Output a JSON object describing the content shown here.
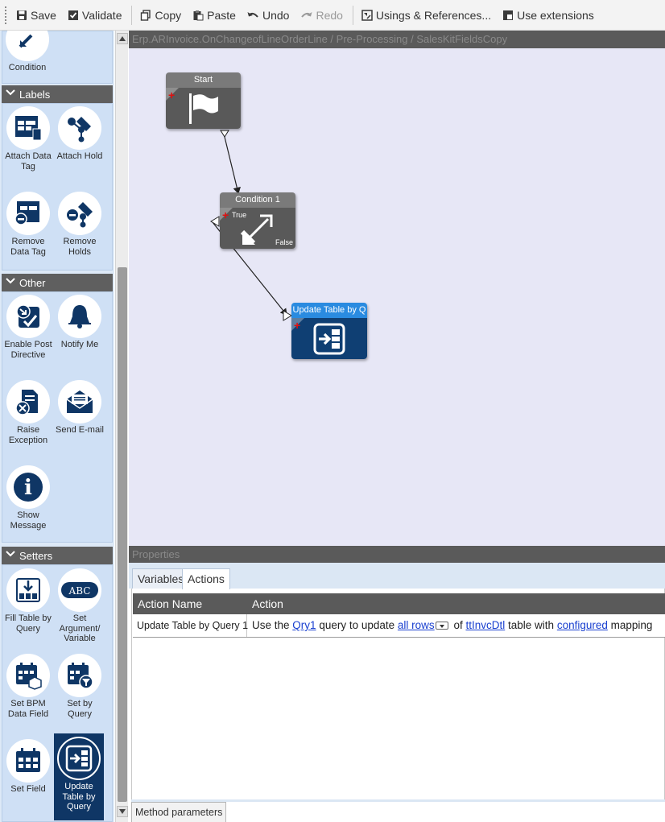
{
  "toolbar": {
    "save": "Save",
    "validate": "Validate",
    "copy": "Copy",
    "paste": "Paste",
    "undo": "Undo",
    "redo": "Redo",
    "usings": "Usings & References...",
    "extensions": "Use extensions"
  },
  "palette": {
    "top_item": "Condition",
    "groups": [
      {
        "name": "Labels",
        "items": [
          "Attach Data Tag",
          "Attach Hold",
          "Remove Data Tag",
          "Remove Holds"
        ]
      },
      {
        "name": "Other",
        "items": [
          "Enable Post Directive",
          "Notify Me",
          "Raise Exception",
          "Send E-mail",
          "Show Message"
        ]
      },
      {
        "name": "Setters",
        "items": [
          "Fill Table by Query",
          "Set Argument/ Variable",
          "Set BPM Data Field",
          "Set by Query",
          "Set Field",
          "Update Table by Query"
        ]
      }
    ]
  },
  "canvas": {
    "title": "Erp.ARInvoice.OnChangeofLineOrderLine / Pre-Processing / SalesKitFieldsCopy",
    "nodes": {
      "start": {
        "title": "Start"
      },
      "condition": {
        "title": "Condition 1",
        "true_label": "True",
        "false_label": "False"
      },
      "update": {
        "title": "Update Table by Q"
      }
    }
  },
  "properties": {
    "title": "Properties",
    "tabs": [
      "Variables",
      "Actions"
    ],
    "active_tab": "Actions",
    "table": {
      "headers": [
        "Action Name",
        "Action"
      ],
      "row": {
        "name": "Update Table by Query 1",
        "p1": "Use the",
        "l1": "Qry1",
        "p2": "query to update",
        "l2": "all rows",
        "p3": "of",
        "l3": "ttInvcDtl",
        "p4": "table with",
        "l4": "configured",
        "p5": "mapping"
      }
    },
    "bottom_tab": "Method parameters"
  },
  "colors": {
    "palette_bg": "#dde9f7",
    "header_gray": "#5f5f5f",
    "canvas_bg": "#e7e7f6",
    "node_gray": "#595959",
    "node_blue": "#0f3f73",
    "node_blue_header": "#2a8be0",
    "link": "#1a40d0"
  }
}
